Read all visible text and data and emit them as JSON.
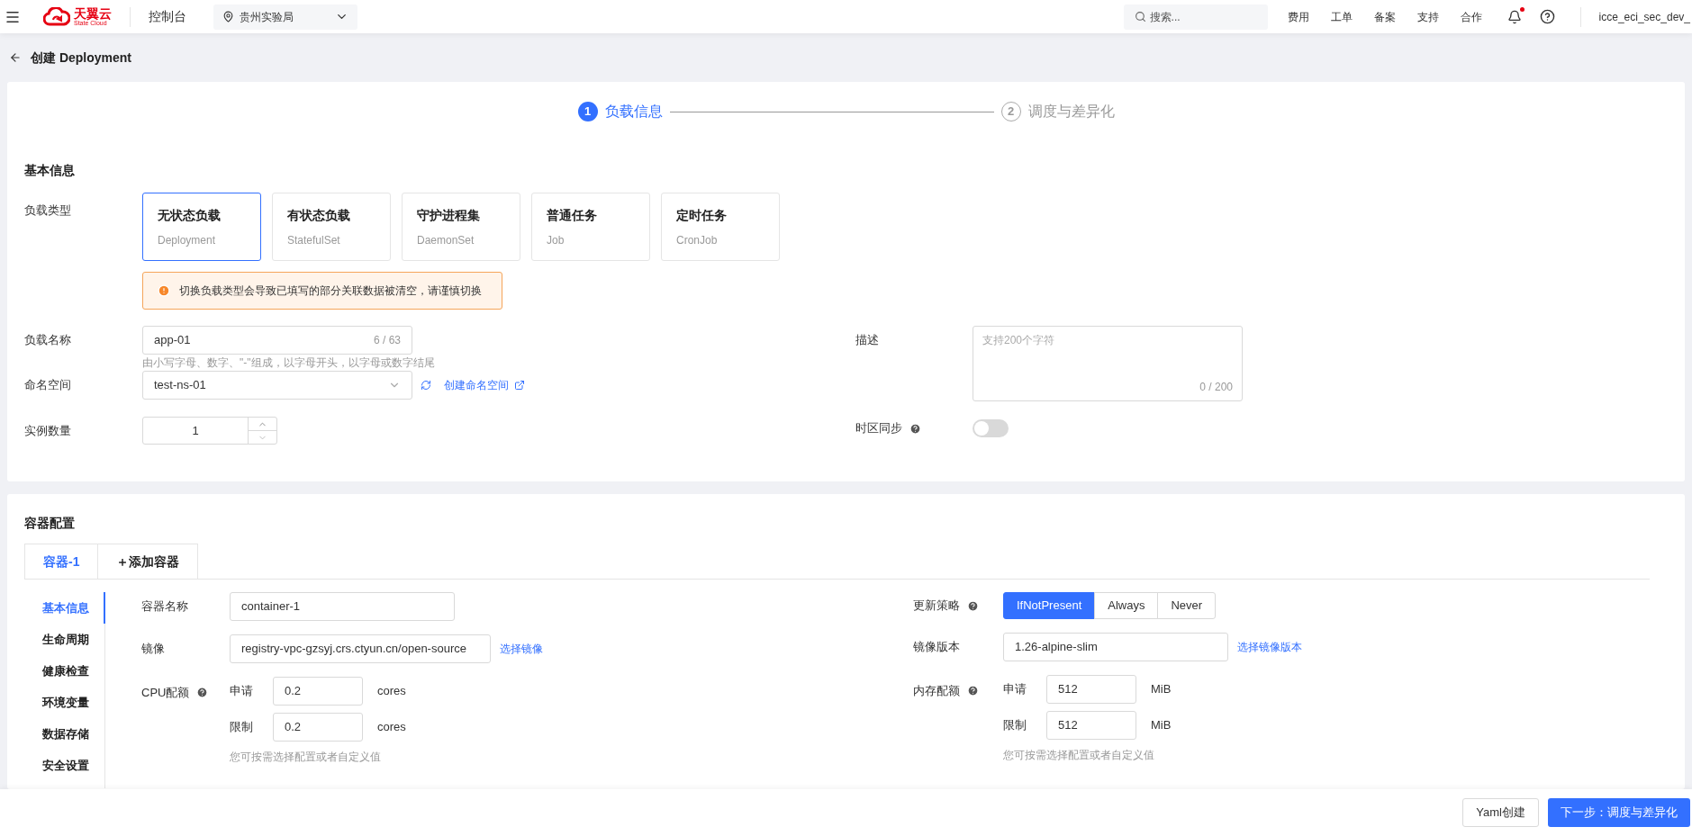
{
  "top_bar": {
    "logo_name": "天翼云",
    "logo_sub": "State Cloud",
    "console": "控制台",
    "region": "贵州实验局",
    "search": {
      "placeholder": "搜索..."
    },
    "links": [
      "费用",
      "工单",
      "备案",
      "支持",
      "合作"
    ],
    "user": "icce_eci_sec_dev_"
  },
  "page_title": "创建 Deployment",
  "steps": [
    {
      "number": "1",
      "label": "负载信息",
      "selected": true
    },
    {
      "number": "2",
      "label": "调度与差异化",
      "selected": false
    }
  ],
  "basic_info": {
    "title": "基本信息",
    "workload_type_label": "负载类型",
    "workload_types": [
      {
        "name": "无状态负载",
        "sub": "Deployment",
        "selected": true
      },
      {
        "name": "有状态负载",
        "sub": "StatefulSet",
        "selected": false
      },
      {
        "name": "守护进程集",
        "sub": "DaemonSet",
        "selected": false
      },
      {
        "name": "普通任务",
        "sub": "Job",
        "selected": false
      },
      {
        "name": "定时任务",
        "sub": "CronJob",
        "selected": false
      }
    ],
    "warning": "切换负载类型会导致已填写的部分关联数据被清空，请谨慎切换",
    "name": {
      "label": "负载名称",
      "value": "app-01",
      "counter": "6 / 63",
      "hint": "由小写字母、数字、\"-\"组成，以字母开头，以字母或数字结尾"
    },
    "namespace": {
      "label": "命名空间",
      "value": "test-ns-01",
      "create_link": "创建命名空间"
    },
    "replicas": {
      "label": "实例数量",
      "value": "1"
    },
    "description": {
      "label": "描述",
      "placeholder": "支持200个字符",
      "counter": "0 / 200"
    },
    "timezone_sync": {
      "label": "时区同步",
      "on": false
    }
  },
  "container_config": {
    "title": "容器配置",
    "tabs": [
      {
        "label": "容器-1",
        "selected": true
      },
      {
        "label": "＋添加容器",
        "selected": false
      }
    ],
    "side_nav": [
      {
        "label": "基本信息",
        "selected": true
      },
      {
        "label": "生命周期",
        "selected": false
      },
      {
        "label": "健康检查",
        "selected": false
      },
      {
        "label": "环境变量",
        "selected": false
      },
      {
        "label": "数据存储",
        "selected": false
      },
      {
        "label": "安全设置",
        "selected": false
      }
    ],
    "container_name": {
      "label": "容器名称",
      "value": "container-1"
    },
    "image": {
      "label": "镜像",
      "value": "registry-vpc-gzsyj.crs.ctyun.cn/open-source",
      "link": "选择镜像"
    },
    "cpu": {
      "label": "CPU配额",
      "request_label": "申请",
      "request": "0.2",
      "request_unit": "cores",
      "limit_label": "限制",
      "limit": "0.2",
      "limit_unit": "cores",
      "hint": "您可按需选择配置或者自定义值"
    },
    "pull_policy": {
      "label": "更新策略",
      "options": [
        {
          "label": "IfNotPresent",
          "selected": true
        },
        {
          "label": "Always",
          "selected": false
        },
        {
          "label": "Never",
          "selected": false
        }
      ]
    },
    "image_version": {
      "label": "镜像版本",
      "value": "1.26-alpine-slim",
      "link": "选择镜像版本"
    },
    "memory": {
      "label": "内存配额",
      "request_label": "申请",
      "request": "512",
      "request_unit": "MiB",
      "limit_label": "限制",
      "limit": "512",
      "limit_unit": "MiB",
      "hint": "您可按需选择配置或者自定义值"
    }
  },
  "footer": {
    "yaml_button": "Yaml创建",
    "next_button": "下一步：调度与差异化"
  }
}
